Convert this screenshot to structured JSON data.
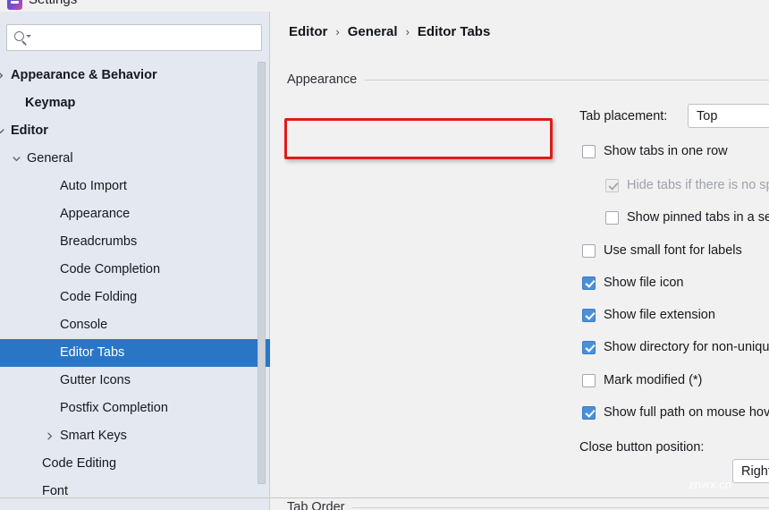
{
  "window": {
    "title": "Settings",
    "icon": "ide-logo-icon"
  },
  "sidebar": {
    "search": {
      "value": "",
      "placeholder": ""
    },
    "items": [
      {
        "label": "Appearance & Behavior",
        "indent": 12,
        "chevron": "right",
        "bold": true,
        "selected": false
      },
      {
        "label": "Keymap",
        "indent": 28,
        "chevron": "none",
        "bold": true,
        "selected": false
      },
      {
        "label": "Editor",
        "indent": 12,
        "chevron": "down",
        "bold": true,
        "selected": false
      },
      {
        "label": "General",
        "indent": 30,
        "chevron": "down",
        "bold": false,
        "selected": false
      },
      {
        "label": "Auto Import",
        "indent": 67,
        "chevron": "none",
        "bold": false,
        "selected": false
      },
      {
        "label": "Appearance",
        "indent": 67,
        "chevron": "none",
        "bold": false,
        "selected": false
      },
      {
        "label": "Breadcrumbs",
        "indent": 67,
        "chevron": "none",
        "bold": false,
        "selected": false
      },
      {
        "label": "Code Completion",
        "indent": 67,
        "chevron": "none",
        "bold": false,
        "selected": false
      },
      {
        "label": "Code Folding",
        "indent": 67,
        "chevron": "none",
        "bold": false,
        "selected": false
      },
      {
        "label": "Console",
        "indent": 67,
        "chevron": "none",
        "bold": false,
        "selected": false
      },
      {
        "label": "Editor Tabs",
        "indent": 67,
        "chevron": "none",
        "bold": false,
        "selected": true
      },
      {
        "label": "Gutter Icons",
        "indent": 67,
        "chevron": "none",
        "bold": false,
        "selected": false
      },
      {
        "label": "Postfix Completion",
        "indent": 67,
        "chevron": "none",
        "bold": false,
        "selected": false
      },
      {
        "label": "Smart Keys",
        "indent": 67,
        "chevron": "right",
        "bold": false,
        "selected": false
      },
      {
        "label": "Code Editing",
        "indent": 47,
        "chevron": "none",
        "bold": false,
        "selected": false
      },
      {
        "label": "Font",
        "indent": 47,
        "chevron": "none",
        "bold": false,
        "selected": false
      }
    ]
  },
  "breadcrumb": {
    "items": [
      "Editor",
      "General",
      "Editor Tabs"
    ],
    "separator": "›"
  },
  "main": {
    "sections": {
      "appearance": "Appearance",
      "tab_order": "Tab Order"
    },
    "tab_placement": {
      "label": "Tab placement:",
      "value": "Top"
    },
    "close_button": {
      "label": "Close button position:",
      "value": "Right"
    },
    "checkboxes": [
      {
        "label": "Show tabs in one row",
        "checked": false,
        "disabled": false
      },
      {
        "label": "Hide tabs if there is no space",
        "checked": true,
        "disabled": true
      },
      {
        "label": "Show pinned tabs in a separate row",
        "checked": false,
        "disabled": false
      },
      {
        "label": "Use small font for labels",
        "checked": false,
        "disabled": false
      },
      {
        "label": "Show file icon",
        "checked": true,
        "disabled": false
      },
      {
        "label": "Show file extension",
        "checked": true,
        "disabled": false
      },
      {
        "label": "Show directory for non-unique file names",
        "checked": true,
        "disabled": false
      },
      {
        "label": "Mark modified (*)",
        "checked": false,
        "disabled": false
      },
      {
        "label": "Show full path on mouse hover",
        "checked": true,
        "disabled": false
      }
    ]
  },
  "annotation": {
    "highlight_target": "Show tabs in one row",
    "color": "#e01b17"
  },
  "watermark": {
    "text": "znwx.cn"
  },
  "colors": {
    "selection": "#2a76c6",
    "checkbox_checked": "#4a90d9",
    "sidebar_bg": "#e4e8f0",
    "content_bg": "#f1f1f1",
    "annotation": "#e01b17"
  }
}
